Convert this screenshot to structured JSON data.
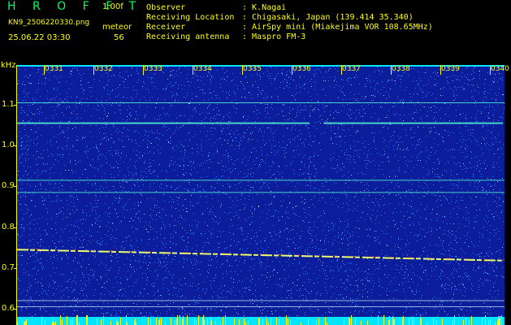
{
  "header": {
    "app_title": "H R O F F T",
    "version": "1.00f",
    "filename": "KN9_2506220330.png",
    "meteor_label": "meteor",
    "timestamp": "25.06.22 03:30",
    "meteor_count": "56"
  },
  "info": [
    {
      "label": "Observer",
      "value": ": K.Nagai"
    },
    {
      "label": "Receiving Location",
      "value": ": Chigasaki, Japan (139.414 35.340)"
    },
    {
      "label": "Receiver",
      "value": ": AirSpy mini (Miakejima VOR 108.65MHz)"
    },
    {
      "label": "Receiving antenna",
      "value": ": Maspro FM-3"
    }
  ],
  "chart_data": {
    "type": "heatmap",
    "ylabel": "kHz",
    "y_ticks": [
      "1.1",
      "1.0",
      "0.9",
      "0.8",
      "0.7",
      "0.6"
    ],
    "x_ticks": [
      "0331",
      "0332",
      "0333",
      "0334",
      "0335",
      "0336",
      "0337",
      "0338",
      "0339",
      "0340"
    ],
    "horizontal_lines_khz": [
      1.105,
      1.055,
      0.915,
      0.885,
      0.62,
      0.605
    ],
    "trace": {
      "start_khz": 0.745,
      "end_khz": 0.718
    },
    "colors": {
      "background": "#0b1d9a",
      "noise": "#2f7bff",
      "line": "#46d3c9",
      "trace": "#e8ff6a",
      "bottom_band": "#00e5ff",
      "text": "#ffff00"
    }
  }
}
